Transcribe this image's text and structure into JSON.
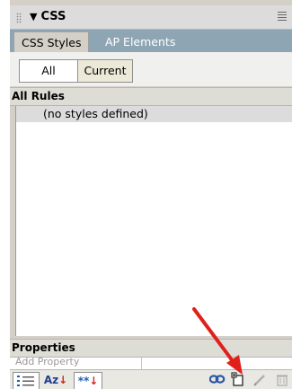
{
  "panel": {
    "title": "CSS",
    "collapse_glyph": "▼"
  },
  "tabs": [
    {
      "label": "CSS Styles",
      "active": true
    },
    {
      "label": "AP Elements",
      "active": false
    }
  ],
  "view_toggle": {
    "all_label": "All",
    "current_label": "Current",
    "selected": "All"
  },
  "all_rules": {
    "heading": "All Rules",
    "items": [
      "(no styles defined)"
    ]
  },
  "properties": {
    "heading": "Properties",
    "add_property_label": "Add Property"
  },
  "bottom_toolbar": {
    "az_label": "Az",
    "set_label": "**",
    "icons": [
      "category-view-icon",
      "alphabetical-view-icon",
      "set-properties-view-icon",
      "attach-stylesheet-icon",
      "new-css-rule-icon",
      "edit-style-icon",
      "delete-css-rule-icon"
    ]
  },
  "colors": {
    "tab_strip": "#8ea6b4",
    "arrow": "#e0201a",
    "accent_blue": "#1f5fb0",
    "accent_red": "#cc2a1f"
  }
}
